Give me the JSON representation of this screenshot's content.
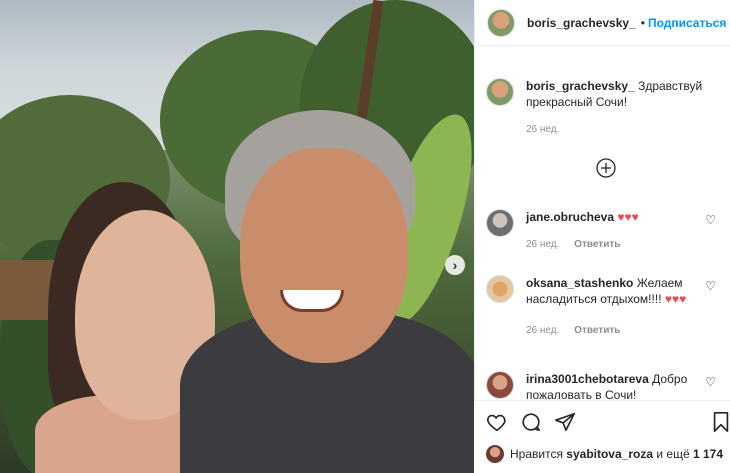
{
  "header": {
    "username": "boris_grachevsky_",
    "separator": "•",
    "follow_label": "Подписаться"
  },
  "caption": {
    "username": "boris_grachevsky_",
    "text": "Здравствуй прекрасный Сочи!",
    "time": "26 нед."
  },
  "load_more": {
    "icon": "plus-circle-icon"
  },
  "comments": [
    {
      "username": "jane.obrucheva",
      "text": "",
      "hearts": "♥♥♥",
      "time": "26 нед.",
      "reply": "Ответить"
    },
    {
      "username": "oksana_stashenko",
      "text": "Желаем насладиться отдыхом!!!!",
      "hearts": "♥♥♥",
      "time": "26 нед.",
      "reply": "Ответить"
    },
    {
      "username": "irina3001chebotareva",
      "text": "Добро пожаловать в Сочи!"
    }
  ],
  "actions": {
    "like_icon": "heart-icon",
    "comment_icon": "comment-icon",
    "share_icon": "share-icon",
    "save_icon": "bookmark-icon"
  },
  "likes": {
    "prefix": "Нравится",
    "user": "syabitova_roza",
    "suffix": "и ещё",
    "count": "1 174"
  },
  "colors": {
    "follow": "#0095f6",
    "heart": "#ed4956",
    "muted": "#8e8e8e"
  }
}
